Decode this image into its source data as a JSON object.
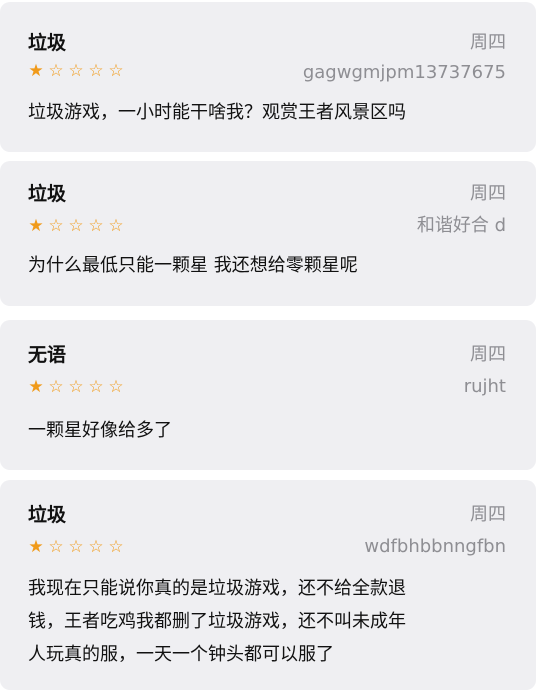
{
  "reviews": [
    {
      "title": "垃圾",
      "date": "周四",
      "rating": 1,
      "max_rating": 5,
      "author": "gagwgmjpm13737675",
      "body": "垃圾游戏，一小时能干啥我？观赏王者风景区吗"
    },
    {
      "title": "垃圾",
      "date": "周四",
      "rating": 1,
      "max_rating": 5,
      "author": "和谐好合 d",
      "body": "为什么最低只能一颗星 我还想给零颗星呢"
    },
    {
      "title": "无语",
      "date": "周四",
      "rating": 1,
      "max_rating": 5,
      "author": "rujht",
      "body": "一颗星好像给多了"
    },
    {
      "title": "垃圾",
      "date": "周四",
      "rating": 1,
      "max_rating": 5,
      "author": "wdfbhbbnngfbn",
      "body_lines": [
        "我现在只能说你真的是垃圾游戏，还不给全款退",
        "钱，王者吃鸡我都删了垃圾游戏，还不叫未成年",
        "人玩真的服，一天一个钟头都可以服了"
      ]
    }
  ],
  "star_glyphs": {
    "filled": "★",
    "empty": "☆"
  },
  "colors": {
    "star": "#f09a1a",
    "card_bg": "#efeff2",
    "meta": "#8e8e93"
  }
}
